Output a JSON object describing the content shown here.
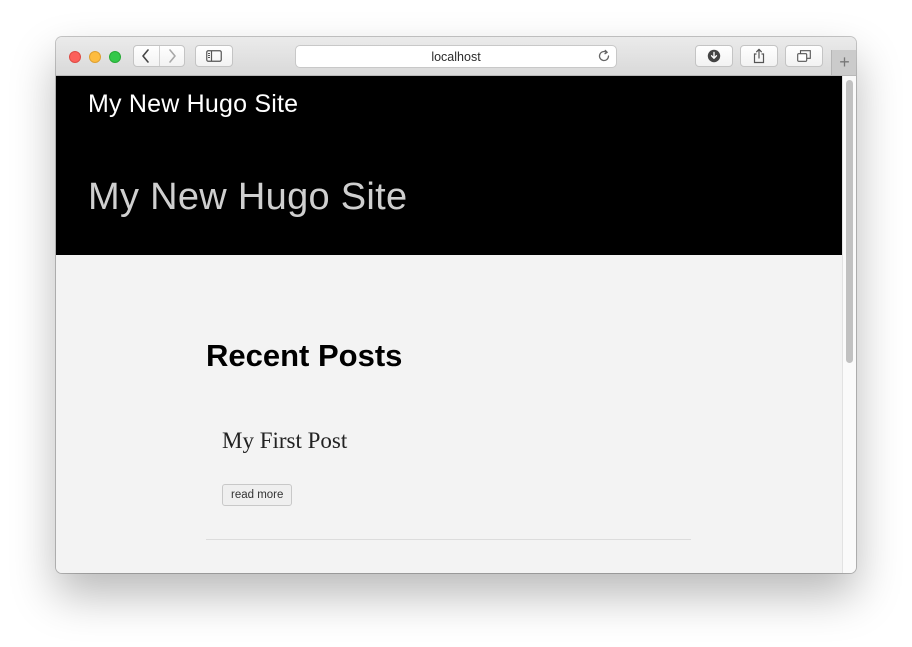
{
  "browser": {
    "url_text": "localhost",
    "new_tab_label": "+"
  },
  "header": {
    "brand": "My New Hugo Site",
    "hero_title": "My New Hugo Site"
  },
  "main": {
    "section_title": "Recent Posts",
    "posts": [
      {
        "title": "My First Post",
        "read_more_label": "read more"
      }
    ]
  },
  "colors": {
    "hero_bg": "#000000",
    "page_bg": "#f3f3f3"
  },
  "icons": [
    "back-icon",
    "forward-icon",
    "sidebar-icon",
    "reload-icon",
    "download-icon",
    "share-icon",
    "tabs-icon"
  ]
}
